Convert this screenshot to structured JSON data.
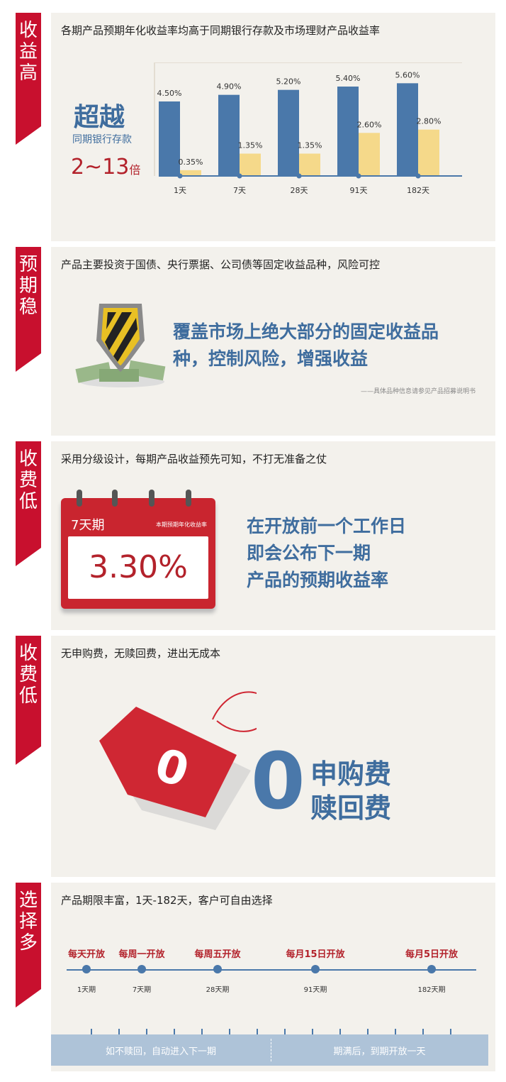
{
  "sections": [
    {
      "ribbon": [
        "收",
        "益",
        "高"
      ],
      "title": "各期产品预期年化收益率均高于同期银行存款及市场理财产品收益率"
    },
    {
      "ribbon": [
        "预",
        "期",
        "稳"
      ],
      "title": "产品主要投资于国债、央行票据、公司债等固定收益品种，风险可控"
    },
    {
      "ribbon": [
        "收",
        "费",
        "低"
      ],
      "title": "采用分级设计，每期产品收益预先可知，不打无准备之仗"
    },
    {
      "ribbon": [
        "收",
        "费",
        "低"
      ],
      "title": "无申购费，无赎回费，进出无成本"
    },
    {
      "ribbon": [
        "选",
        "择",
        "多"
      ],
      "title": "产品期限丰富，1天-182天，客户可自由选择"
    }
  ],
  "yield_panel": {
    "headline": "超越",
    "subline": "同期银行存款",
    "multiple": "2~13",
    "multiple_unit": "倍"
  },
  "chart_data": {
    "type": "bar",
    "categories": [
      "1天",
      "7天",
      "28天",
      "91天",
      "182天"
    ],
    "series": [
      {
        "values": [
          4.5,
          4.9,
          5.2,
          5.4,
          5.6
        ],
        "labels": [
          "4.50%",
          "4.90%",
          "5.20%",
          "5.40%",
          "5.60%"
        ],
        "color": "#4a78aa"
      },
      {
        "values": [
          0.35,
          1.35,
          1.35,
          2.6,
          2.8
        ],
        "labels": [
          "0.35%",
          "1.35%",
          "1.35%",
          "2.60%",
          "2.80%"
        ],
        "color": "#f5d98a"
      }
    ],
    "ylim": [
      0,
      6
    ]
  },
  "stable_panel": {
    "line1": "覆盖市场上绝大部分的固定收益品",
    "line2": "种，控制风险，增强收益",
    "note": "——具体品种信息请参见产品招募说明书"
  },
  "calendar_panel": {
    "period": "7天期",
    "tag": "本期预期年化收益率",
    "rate": "3.30%",
    "line1": "在开放前一个工作日",
    "line2": "即会公布下一期",
    "line3": "产品的预期收益率"
  },
  "fee_panel": {
    "tag_value": "0",
    "big_zero": "0",
    "line1": "申购费",
    "line2": "赎回费"
  },
  "timeline_panel": {
    "nodes": [
      {
        "top": "每天开放",
        "bottom": "1天期"
      },
      {
        "top": "每周一开放",
        "bottom": "7天期"
      },
      {
        "top": "每周五开放",
        "bottom": "28天期"
      },
      {
        "top": "每月15日开放",
        "bottom": "91天期"
      },
      {
        "top": "每月5日开放",
        "bottom": "182天期"
      }
    ],
    "banner_left": "如不赎回，自动进入下一期",
    "banner_right": "期满后，到期开放一天"
  },
  "colors": {
    "ribbon": "#c8102e",
    "accent_blue": "#3f6d9e",
    "accent_red": "#b3222b",
    "bar_blue": "#4a78aa",
    "bar_yellow": "#f5d98a"
  }
}
